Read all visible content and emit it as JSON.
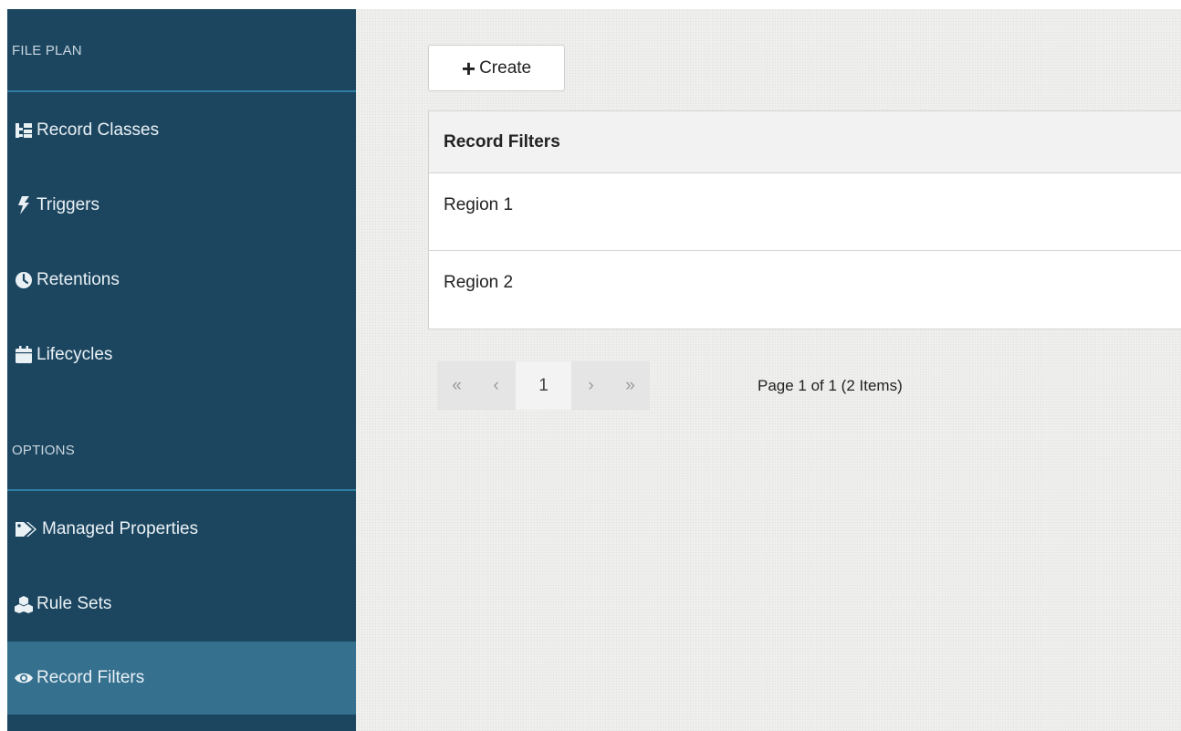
{
  "sidebar": {
    "file_plan_title": "FILE PLAN",
    "options_title": "OPTIONS",
    "items": [
      {
        "label": "Record Classes",
        "icon": "record-classes-icon"
      },
      {
        "label": "Triggers",
        "icon": "bolt-icon"
      },
      {
        "label": "Retentions",
        "icon": "clock-icon"
      },
      {
        "label": "Lifecycles",
        "icon": "calendar-icon"
      },
      {
        "label": "Managed Properties",
        "icon": "tags-icon"
      },
      {
        "label": "Rule Sets",
        "icon": "cubes-icon"
      },
      {
        "label": "Record Filters",
        "icon": "eye-icon",
        "active": true
      }
    ],
    "colors": {
      "background": "#1c4660",
      "active": "#35708f",
      "divider": "#2e7da3"
    }
  },
  "main": {
    "create_label": "Create",
    "table": {
      "header": "Record Filters",
      "rows": [
        "Region 1",
        "Region 2"
      ]
    },
    "pagination": {
      "first": "«",
      "prev": "‹",
      "current_page": "1",
      "next": "›",
      "last": "»",
      "info": "Page 1 of 1 (2 Items)"
    }
  }
}
